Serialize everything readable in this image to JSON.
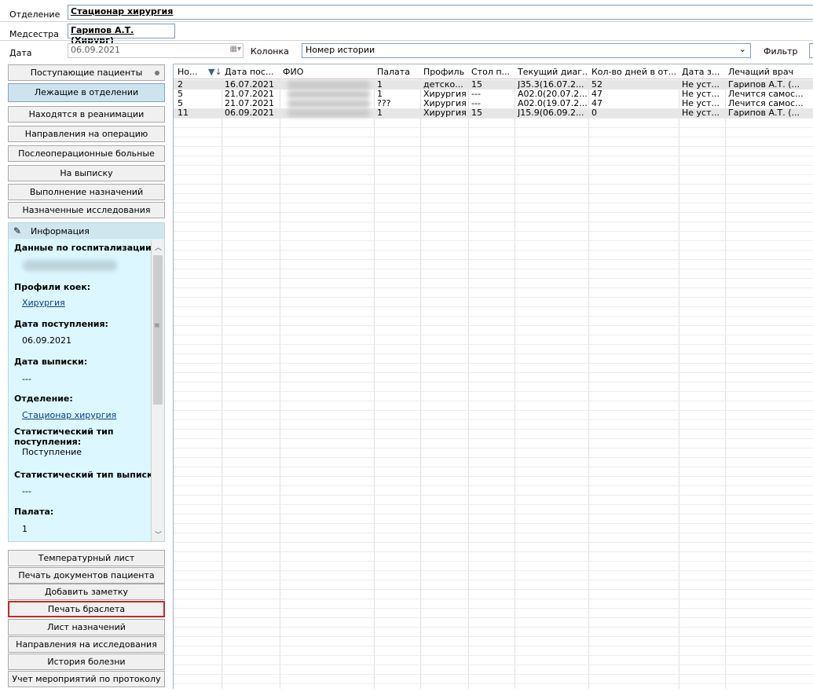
{
  "header": {
    "department_label": "Отделение",
    "department_value": "Стационар хирургия",
    "nurse_label": "Медсестра",
    "nurse_value": "Гарипов А.Т. (Хирург)",
    "date_label": "Дата",
    "date_value": "06.09.2021",
    "column_label": "Колонка",
    "column_value": "Номер истории",
    "filter_label": "Фильтр"
  },
  "nav": {
    "items": [
      "Поступающие пациенты",
      "Лежащие в отделении",
      "Находятся в реанимации",
      "Направления на операцию",
      "Послеоперационные больные",
      "На выписку",
      "Выполнение назначений",
      "Назначенные исследования"
    ]
  },
  "info": {
    "title": "Информация",
    "hosp_label": "Данные по госпитализации:",
    "bed_profiles_label": "Профили коек:",
    "bed_profiles_value": "Хирургия",
    "admission_date_label": "Дата поступления:",
    "admission_date_value": "06.09.2021",
    "discharge_date_label": "Дата выписки:",
    "discharge_date_value": "---",
    "department_label": "Отделение:",
    "department_value": "Стационар хирургия",
    "stat_admission_label_1": "Статистический тип",
    "stat_admission_label_2": "поступления:",
    "stat_admission_value": "Поступление",
    "stat_discharge_label": "Статистический тип выписки:",
    "stat_discharge_value": "---",
    "ward_label": "Палата:",
    "ward_value": "1"
  },
  "actions": [
    "Температурный лист",
    "Печать документов пациента",
    "Добавить заметку",
    "Печать браслета",
    "Лист назначений",
    "Направления на исследования",
    "История болезни",
    "Учет мероприятий по протоколу"
  ],
  "grid": {
    "columns": [
      "Но...",
      "Дата пос...",
      "ФИО",
      "Палата",
      "Профиль",
      "Стол п...",
      "Текущий диаг...",
      "Кол-во дней в от...",
      "Дата з...",
      "Лечащий врач"
    ],
    "rows": [
      [
        "2",
        "16.07.2021",
        "",
        "1",
        "детско...",
        "15",
        "J35.3(16.07.2...",
        "52",
        "Не уст...",
        "Гарипов А.Т. (..."
      ],
      [
        "5",
        "21.07.2021",
        "",
        "1",
        "Хирургия",
        "---",
        "A02.0(20.07.2...",
        "47",
        "Не уст...",
        "Лечится самос..."
      ],
      [
        "5",
        "21.07.2021",
        "",
        "???",
        "Хирургия",
        "---",
        "A02.0(19.07.2...",
        "47",
        "Не уст...",
        "Лечится самос..."
      ],
      [
        "11",
        "06.09.2021",
        "",
        "1",
        "Хирургия",
        "15",
        "J15.9(06.09.2...",
        "0",
        "Не уст...",
        "Гарипов А.Т. (..."
      ]
    ],
    "sort_icon": "sort-filter-icon"
  }
}
